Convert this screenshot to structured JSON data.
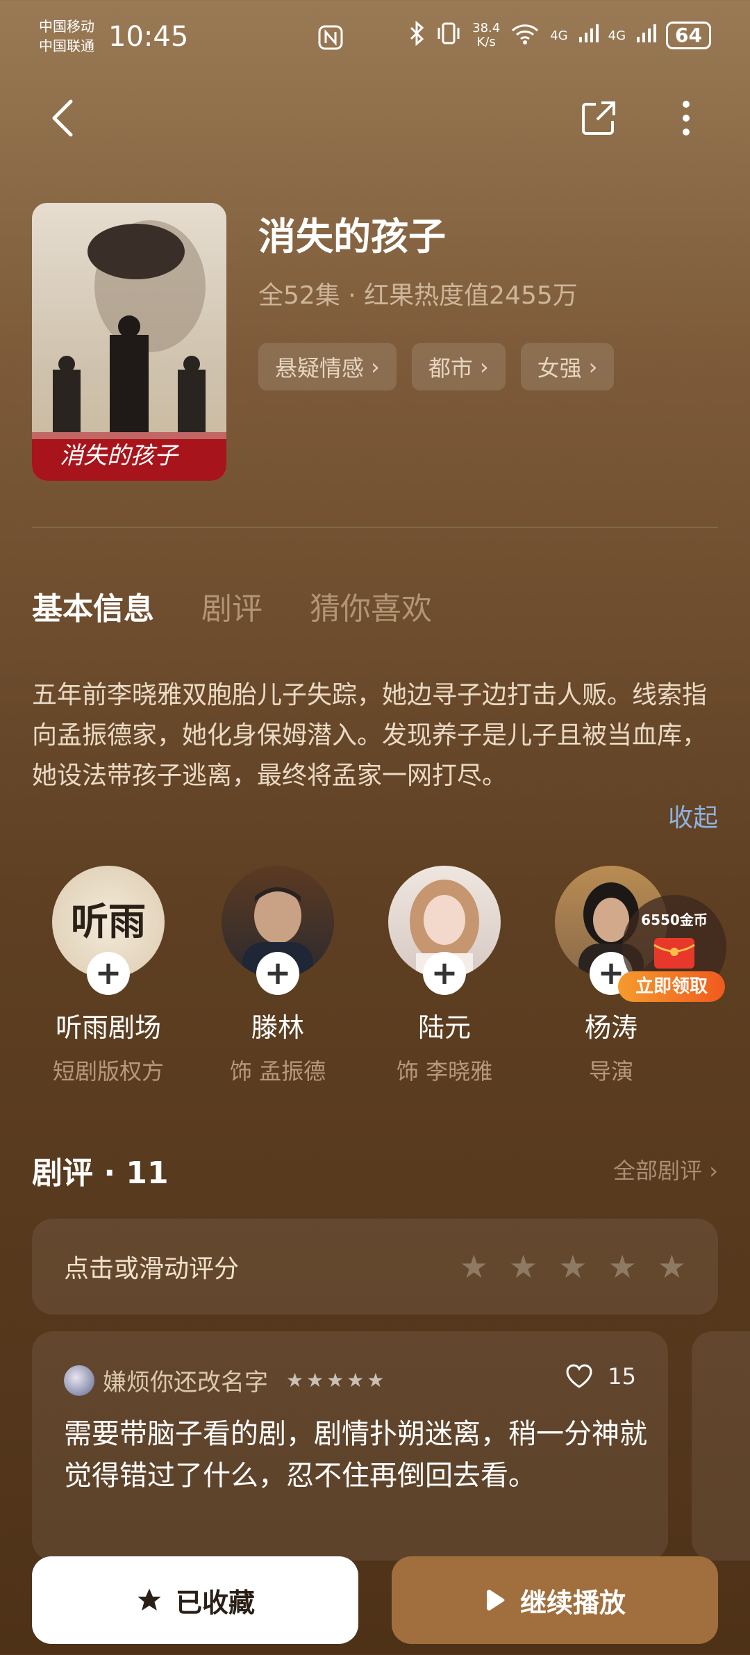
{
  "status_bar": {
    "carrier1": "中国移动",
    "carrier2": "中国联通",
    "time": "10:45",
    "net_speed_value": "38.4",
    "net_speed_unit": "K/s",
    "wifi_extra": "6",
    "signal1": "4G",
    "signal2": "4G",
    "battery": "64"
  },
  "drama": {
    "title": "消失的孩子",
    "meta": "全52集 · 红果热度值2455万",
    "tags": [
      "悬疑情感",
      "都市",
      "女强"
    ],
    "poster_title": "消失的孩子"
  },
  "tabs": [
    "基本信息",
    "剧评",
    "猜你喜欢"
  ],
  "synopsis": "五年前李晓雅双胞胎儿子失踪，她边寻子边打击人贩。线索指向孟振德家，她化身保姆潜入。发现养子是儿子且被当血库，她设法带孩子逃离，最终将孟家一网打尽。",
  "collapse_label": "收起",
  "cast": [
    {
      "name": "听雨剧场",
      "role": "短剧版权方",
      "logo_text": "听雨"
    },
    {
      "name": "滕林",
      "role": "饰 孟振德"
    },
    {
      "name": "陆元",
      "role": "饰 李晓雅"
    },
    {
      "name": "杨涛",
      "role": "导演"
    }
  ],
  "gift": {
    "coins": "6550金币",
    "claim": "立即领取"
  },
  "reviews": {
    "title": "剧评 · 11",
    "all_label": "全部剧评",
    "rate_prompt": "点击或滑动评分",
    "items": [
      {
        "user": "嫌烦你还改名字",
        "likes": "15",
        "text": "需要带脑子看的剧，剧情扑朔迷离，稍一分神就觉得错过了什么，忍不住再倒回去看。"
      }
    ]
  },
  "buttons": {
    "favorite": "已收藏",
    "play": "继续播放"
  },
  "colors": {
    "accent_play": "#a16f3e",
    "link_blue": "#8fb2e0"
  }
}
